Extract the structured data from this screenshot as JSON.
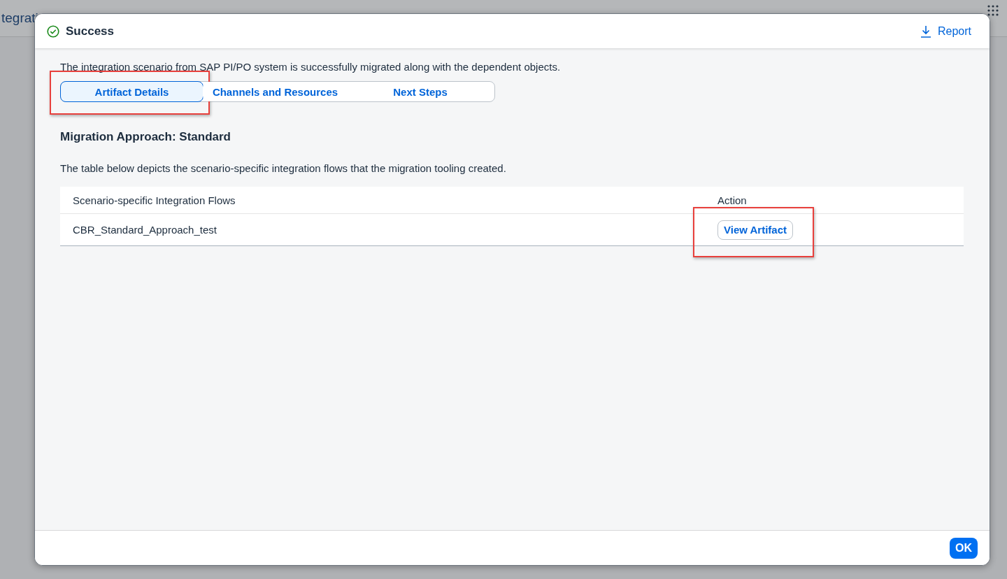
{
  "background_app": {
    "title": "tegrati"
  },
  "dialog": {
    "title": "Success",
    "kind": "success",
    "report_button": "Report",
    "message": "The integration scenario from SAP PI/PO system is successfully migrated along with the dependent objects.",
    "tabs": [
      {
        "label": "Artifact Details",
        "selected": true,
        "highlighted": true
      },
      {
        "label": "Channels and Resources",
        "selected": false,
        "highlighted": false
      },
      {
        "label": "Next Steps",
        "selected": false,
        "highlighted": false
      }
    ],
    "heading": "Migration Approach: Standard",
    "description": "The table below depicts the scenario-specific integration flows that the migration tooling created.",
    "table": {
      "columns": [
        "Scenario-specific Integration Flows",
        "Action"
      ],
      "rows": [
        {
          "flow": "CBR_Standard_Approach_test",
          "action": "View Artifact",
          "highlighted": true
        }
      ]
    },
    "ok_button": "OK"
  }
}
